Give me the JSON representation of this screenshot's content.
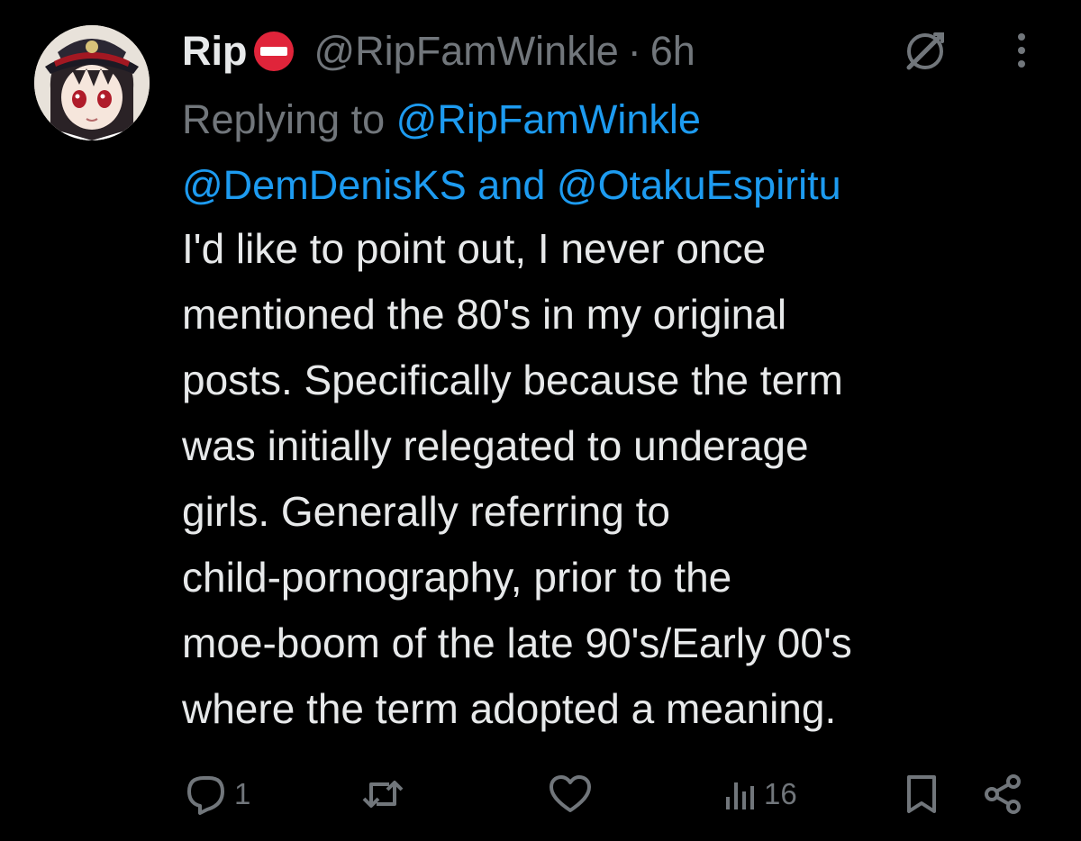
{
  "tweet": {
    "display_name": "Rip",
    "handle": "@RipFamWinkle",
    "separator": "·",
    "time": "6h",
    "replying_prefix": "Replying to",
    "reply_mentions": [
      "@RipFamWinkle",
      "@DemDenisKS",
      "@OtakuEspiritu"
    ],
    "reply_joiner": "and",
    "body_lines": [
      "I'd like to point out, I never once",
      "mentioned the 80's in my original",
      "posts. Specifically because the term",
      "was initially relegated to underage",
      "girls. Generally referring to",
      "child-pornography, prior to the",
      "moe-boom of the late 90's/Early 00's",
      "where the term adopted a meaning."
    ]
  },
  "actions": {
    "reply_count": "1",
    "repost_count": "",
    "like_count": "",
    "view_count": "16"
  },
  "icons": {
    "badge": "no-entry-emoji-icon",
    "grok": "grok-icon",
    "more": "more-vertical-icon",
    "reply": "reply-icon",
    "repost": "repost-icon",
    "like": "heart-icon",
    "views": "views-icon",
    "bookmark": "bookmark-icon",
    "share": "share-icon"
  },
  "colors": {
    "background": "#000000",
    "text": "#e7e9ea",
    "secondary": "#71767b",
    "link": "#1d9bf0",
    "badge_red": "#e0243a"
  }
}
